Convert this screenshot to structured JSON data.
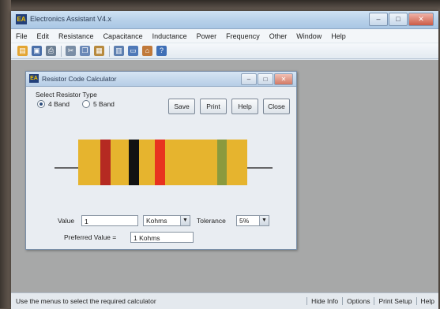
{
  "app": {
    "title": "Electronics Assistant V4.x",
    "window_controls": {
      "minimize": "–",
      "maximize": "□",
      "close": "✕"
    }
  },
  "menu": [
    "File",
    "Edit",
    "Resistance",
    "Capacitance",
    "Inductance",
    "Power",
    "Frequency",
    "Other",
    "Window",
    "Help"
  ],
  "toolbar": {
    "icons": [
      {
        "name": "open-icon",
        "color": "#e3a532",
        "glyph": "▤"
      },
      {
        "name": "save-icon",
        "color": "#4a6fa8",
        "glyph": "▣"
      },
      {
        "name": "print-icon",
        "color": "#6d7f93",
        "glyph": "⎙"
      },
      {
        "name": "cut-icon",
        "color": "#7a8ea6",
        "glyph": "✂"
      },
      {
        "name": "copy-icon",
        "color": "#6b89b7",
        "glyph": "❐"
      },
      {
        "name": "paste-icon",
        "color": "#b78a3e",
        "glyph": "▦"
      },
      {
        "name": "calculator-icon",
        "color": "#5d7fb0",
        "glyph": "▥"
      },
      {
        "name": "window-icon",
        "color": "#4f79b8",
        "glyph": "▭"
      },
      {
        "name": "home-icon",
        "color": "#c0793a",
        "glyph": "⌂"
      },
      {
        "name": "help-icon",
        "color": "#3f6fb6",
        "glyph": "?"
      }
    ]
  },
  "child_window": {
    "title": "Resistor Code Calculator",
    "controls": {
      "minimize": "–",
      "maximize": "□",
      "close": "✕"
    },
    "resistor_type_label": "Select Resistor Type",
    "radio_options": [
      {
        "label": "4 Band",
        "selected": true
      },
      {
        "label": "5 Band",
        "selected": false
      }
    ],
    "buttons": [
      "Save",
      "Print",
      "Help",
      "Close"
    ],
    "resistor": {
      "body_color": "#e6b42e",
      "lead_color": "#3a3a3a",
      "bands": [
        {
          "name": "band-1",
          "color": "#b52a22"
        },
        {
          "name": "band-2",
          "color": "#121212"
        },
        {
          "name": "band-3",
          "color": "#e8321f"
        },
        {
          "name": "tolerance-band",
          "color": "#8a9a3e"
        }
      ]
    },
    "value_label": "Value",
    "value": "1",
    "unit": "Kohms",
    "tolerance_label": "Tolerance",
    "tolerance": "5%",
    "preferred_label": "Preferred Value =",
    "preferred_value": "1 Kohms"
  },
  "status": {
    "message": "Use the menus to select the required calculator",
    "buttons": [
      "Hide Info",
      "Options",
      "Print Setup",
      "Help"
    ]
  }
}
